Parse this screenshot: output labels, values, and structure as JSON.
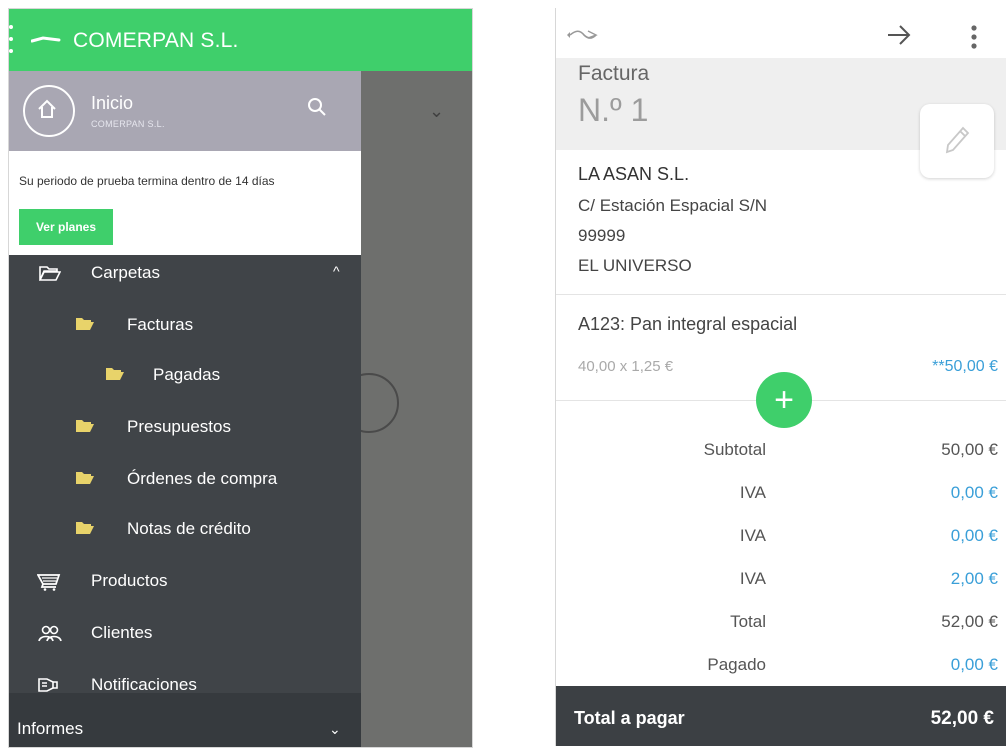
{
  "colors": {
    "accent_green": "#3fcf6b",
    "drawer_dark": "#404448",
    "drawer_header": "#a9a7b3",
    "link_blue": "#3a9fd8",
    "folder_yellow": "#e8d36a",
    "footer_dark": "#3c4044"
  },
  "left": {
    "topbar": {
      "icon": "brand-logo-icon",
      "title": "COMERPAN S.L."
    },
    "drawer": {
      "header": {
        "icon": "home-icon",
        "title": "Inicio",
        "subtitle": "COMERPAN S.L.",
        "search_icon": "search-icon"
      },
      "trial": {
        "message": "Su periodo de prueba termina dentro de 14 días",
        "button": "Ver planes"
      },
      "items": [
        {
          "label": "Carpetas",
          "icon": "folder-open-icon",
          "level": 0,
          "chevron": "^"
        },
        {
          "label": "Facturas",
          "icon": "folder-icon",
          "level": 1
        },
        {
          "label": "Pagadas",
          "icon": "folder-icon",
          "level": 2
        },
        {
          "label": "Presupuestos",
          "icon": "folder-icon",
          "level": 1
        },
        {
          "label": "Órdenes de compra",
          "icon": "folder-icon",
          "level": 1
        },
        {
          "label": "Notas de crédito",
          "icon": "folder-icon",
          "level": 1
        },
        {
          "label": "Productos",
          "icon": "cart-icon",
          "level": 0
        },
        {
          "label": "Clientes",
          "icon": "people-icon",
          "level": 0
        },
        {
          "label": "Notificaciones",
          "icon": "notification-icon",
          "level": 0
        }
      ],
      "bottom": {
        "label": "Informes",
        "chevron": "⌄"
      }
    }
  },
  "right": {
    "topbar": {
      "back_icon": "back-icon",
      "forward_icon": "arrow-right-icon",
      "menu_icon": "more-vert-icon"
    },
    "header": {
      "type": "Factura",
      "number": "N.º 1",
      "edit_icon": "pencil-icon"
    },
    "client": {
      "name": "LA ASAN S.L.",
      "address": "C/ Estación Espacial S/N",
      "postal_code": "99999",
      "city": "EL UNIVERSO"
    },
    "line_item": {
      "description": "A123: Pan integral espacial",
      "quantity_price": "40,00 x 1,25 €",
      "amount": "**50,00 €"
    },
    "add_button": "+",
    "totals": [
      {
        "label": "Subtotal",
        "value": "50,00 €",
        "color": "#555555"
      },
      {
        "label": "IVA",
        "value": "0,00 €",
        "color": "#3a9fd8"
      },
      {
        "label": "IVA",
        "value": "0,00 €",
        "color": "#3a9fd8"
      },
      {
        "label": "IVA",
        "value": "2,00 €",
        "color": "#3a9fd8"
      },
      {
        "label": "Total",
        "value": "52,00 €",
        "color": "#555555"
      },
      {
        "label": "Pagado",
        "value": "0,00 €",
        "color": "#3a9fd8"
      }
    ],
    "footer": {
      "label": "Total a pagar",
      "value": "52,00 €"
    }
  }
}
